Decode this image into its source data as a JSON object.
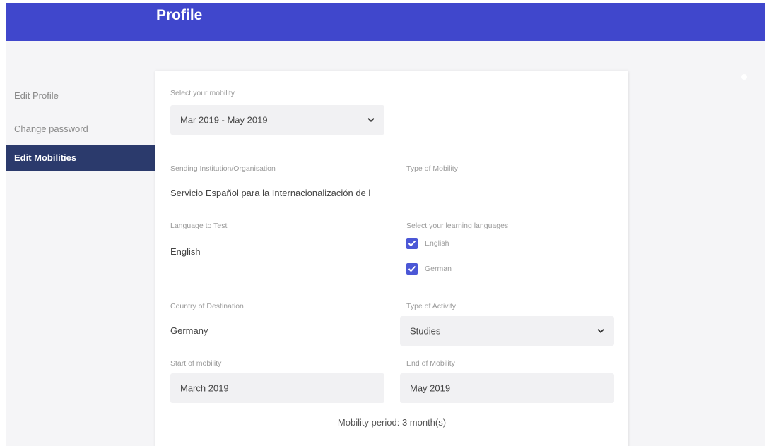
{
  "header": {
    "title": "Profile"
  },
  "sidebar": {
    "items": [
      {
        "label": "Edit Profile"
      },
      {
        "label": "Change password"
      },
      {
        "label": "Edit Mobilities"
      }
    ]
  },
  "form": {
    "mobility_select": {
      "label": "Select your mobility",
      "value": "Mar 2019 - May 2019",
      "icon": "chevron-down-icon"
    },
    "sending_institution": {
      "label": "Sending Institution/Organisation",
      "value": "Servicio Español para la Internacionalización de l"
    },
    "type_of_mobility": {
      "label": "Type of Mobility",
      "value": ""
    },
    "language_to_test": {
      "label": "Language to Test",
      "value": "English"
    },
    "learning_languages": {
      "label": "Select your learning languages",
      "options": [
        {
          "label": "English",
          "checked": true
        },
        {
          "label": "German",
          "checked": true
        }
      ]
    },
    "country_of_destination": {
      "label": "Country of Destination",
      "value": "Germany"
    },
    "type_of_activity": {
      "label": "Type of Activity",
      "value": "Studies"
    },
    "start_of_mobility": {
      "label": "Start of mobility",
      "value": "March 2019"
    },
    "end_of_mobility": {
      "label": "End of Mobility",
      "value": "May 2019"
    },
    "mobility_period": "Mobility period: 3 month(s)"
  },
  "colors": {
    "header": "#4047cc",
    "sidebar_active": "#2b3a6c",
    "checkbox": "#4b57d6"
  }
}
